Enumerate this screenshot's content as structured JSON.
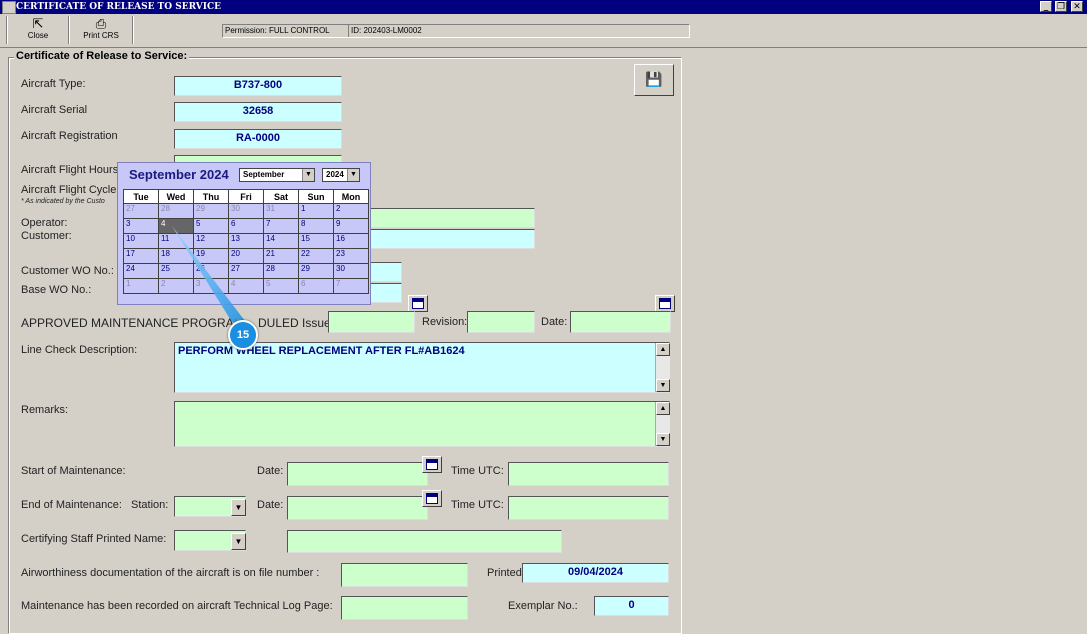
{
  "window": {
    "title": "CERTIFICATE OF RELEASE TO SERVICE",
    "buttons": {
      "minimize": "_",
      "restore": "❐",
      "close": "✕"
    }
  },
  "toolbar": {
    "close_label": "Close",
    "print_label": "Print CRS",
    "permission": "Permission: FULL CONTROL",
    "id": "ID: 202403-LM0002"
  },
  "form": {
    "group_title": "Certificate of Release to Service:",
    "aircraft_type_label": "Aircraft Type:",
    "aircraft_type": "B737-800",
    "aircraft_serial_label": "Aircraft Serial",
    "aircraft_serial": "32658",
    "aircraft_registration_label": "Aircraft Registration",
    "aircraft_registration": "RA-0000",
    "flight_hours_label": "Aircraft Flight Hours",
    "flight_cycles_label": "Aircraft Flight Cycle",
    "indicated_note": "* As indicated by the Custo",
    "operator_label": "Operator:",
    "customer_label": "Customer:",
    "customer_wo_label": "Customer WO No.:",
    "base_wo_label": "Base WO No.:",
    "amp_label": "APPROVED MAINTENANCE PROGRAM",
    "amp_label2": "DULED Issue:",
    "revision_label": "Revision:",
    "date_label": "Date:",
    "line_check_label": "Line Check Description:",
    "line_check_value": "PERFORM WHEEL REPLACEMENT AFTER FL#AB1624",
    "remarks_label": "Remarks:",
    "start_label": "Start of Maintenance:",
    "end_label": "End of Maintenance:",
    "station_label": "Station:",
    "time_utc_label": "Time UTC:",
    "certifying_label": "Certifying Staff Printed Name:",
    "airworthiness_label": "Airworthiness documentation of the aircraft is on file number :",
    "printed_label": "Printed:",
    "printed_value": "09/04/2024",
    "techlog_label": "Maintenance has been recorded on aircraft Technical Log Page:",
    "exemplar_label": "Exemplar No.:",
    "exemplar_value": "0"
  },
  "calendar": {
    "heading": "September 2024",
    "month_select": "September",
    "year_select": "2024",
    "weekdays": [
      "Tue",
      "Wed",
      "Thu",
      "Fri",
      "Sat",
      "Sun",
      "Mon"
    ],
    "weeks": [
      [
        "27",
        "28",
        "29",
        "30",
        "31",
        "1",
        "2"
      ],
      [
        "3",
        "4",
        "5",
        "6",
        "7",
        "8",
        "9"
      ],
      [
        "10",
        "11",
        "12",
        "13",
        "14",
        "15",
        "16"
      ],
      [
        "17",
        "18",
        "19",
        "20",
        "21",
        "22",
        "23"
      ],
      [
        "24",
        "25",
        "26",
        "27",
        "28",
        "29",
        "30"
      ],
      [
        "1",
        "2",
        "3",
        "4",
        "5",
        "6",
        "7"
      ]
    ]
  },
  "annotation": {
    "step": "15"
  }
}
